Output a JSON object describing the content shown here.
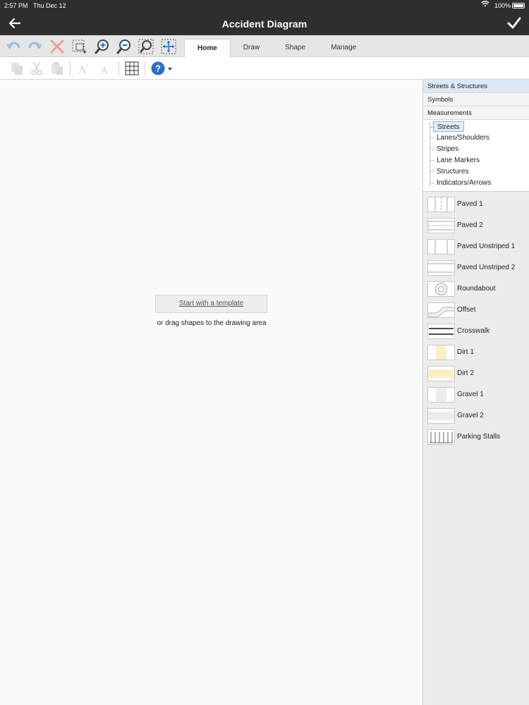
{
  "status": {
    "time": "2:57 PM",
    "date": "Thu Dec 12",
    "battery": "100%"
  },
  "header": {
    "title": "Accident Diagram"
  },
  "tabs": [
    {
      "label": "Home",
      "active": true
    },
    {
      "label": "Draw",
      "active": false
    },
    {
      "label": "Shape",
      "active": false
    },
    {
      "label": "Manage",
      "active": false
    }
  ],
  "canvas": {
    "template_button": "Start with a template",
    "hint": "or drag shapes to the drawing area"
  },
  "panel": {
    "categories": [
      {
        "label": "Streets & Structures",
        "active": true
      },
      {
        "label": "Symbols",
        "active": false
      },
      {
        "label": "Measurements",
        "active": false
      }
    ],
    "tree": [
      {
        "label": "Streets",
        "selected": true
      },
      {
        "label": "Lanes/Shoulders",
        "selected": false
      },
      {
        "label": "Stripes",
        "selected": false
      },
      {
        "label": "Lane Markers",
        "selected": false
      },
      {
        "label": "Structures",
        "selected": false
      },
      {
        "label": "Indicators/Arrows",
        "selected": false
      }
    ],
    "shapes": [
      {
        "label": "Paved 1",
        "icon": "paved-1-thumb"
      },
      {
        "label": "Paved 2",
        "icon": "paved-2-thumb"
      },
      {
        "label": "Paved Unstriped 1",
        "icon": "paved-unstriped-1-thumb"
      },
      {
        "label": "Paved Unstriped 2",
        "icon": "paved-unstriped-2-thumb"
      },
      {
        "label": "Roundabout",
        "icon": "roundabout-thumb"
      },
      {
        "label": "Offset",
        "icon": "offset-thumb"
      },
      {
        "label": "Crosswalk",
        "icon": "crosswalk-thumb"
      },
      {
        "label": "Dirt 1",
        "icon": "dirt-1-thumb"
      },
      {
        "label": "Dirt 2",
        "icon": "dirt-2-thumb"
      },
      {
        "label": "Gravel 1",
        "icon": "gravel-1-thumb"
      },
      {
        "label": "Gravel 2",
        "icon": "gravel-2-thumb"
      },
      {
        "label": "Parking Stalls",
        "icon": "parking-stalls-thumb"
      }
    ]
  },
  "colors": {
    "accent": "#2e6fc1",
    "titlebar": "#2e2e2e",
    "delete": "#e06666",
    "dirt": "#fdeec9"
  }
}
